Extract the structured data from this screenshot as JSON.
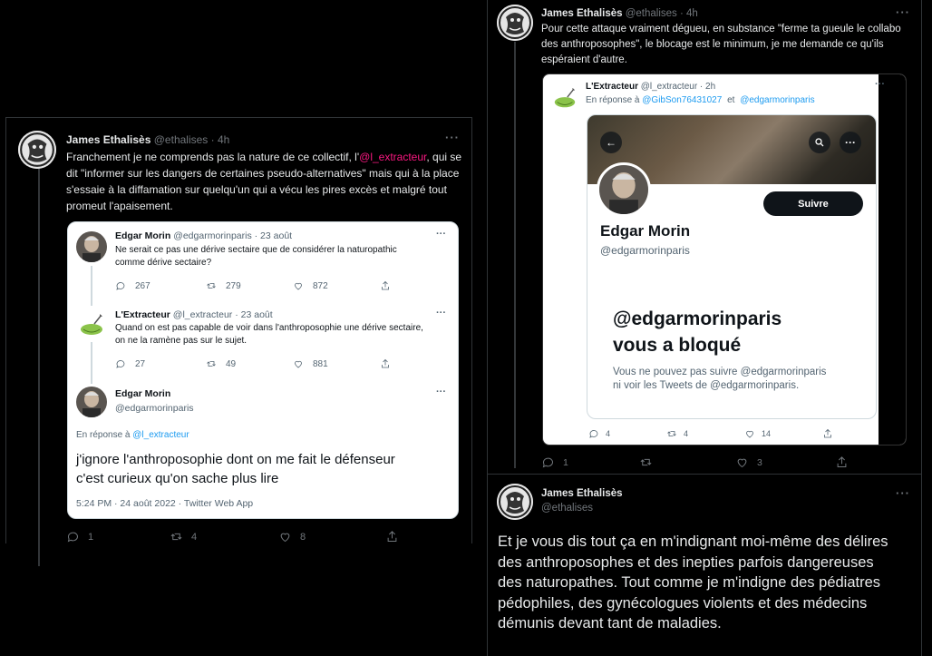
{
  "left_tweet": {
    "author": "James Ethalisès",
    "handle": "@ethalises",
    "time": "· 4h",
    "text_before": "Franchement je ne comprends pas la nature de ce collectif, l'",
    "mention": "@l_extracteur",
    "text_after": ", qui se dit \"informer sur les dangers de certaines pseudo-alternatives\" mais qui à la place s'essaie à la diffamation sur quelqu'un qui a vécu les pires excès et malgré tout promeut l'apaisement.",
    "more": "···",
    "actions": {
      "reply": "1",
      "retweet": "4",
      "like": "8"
    },
    "embedded": {
      "tweet1": {
        "author": "Edgar Morin",
        "meta": "@edgarmorinparis · 23 août",
        "text": "Ne serait ce pas une dérive sectaire que de considérer la naturopathic comme dérive sectaire?",
        "actions": {
          "reply": "267",
          "retweet": "279",
          "like": "872"
        }
      },
      "tweet2": {
        "author": "L'Extracteur",
        "meta": "@l_extracteur · 23 août",
        "text": "Quand on est pas capable de voir dans l'anthroposophie une dérive sectaire, on ne la ramène pas sur le sujet.",
        "actions": {
          "reply": "27",
          "retweet": "49",
          "like": "881"
        }
      },
      "tweet3": {
        "author": "Edgar Morin",
        "handle": "@edgarmorinparis",
        "reply_to_label": "En réponse à",
        "reply_to": "@l_extracteur",
        "text_line1": "j'ignore l'anthroposophie dont on me fait le défenseur",
        "text_line2": "c'est curieux qu'on sache plus lire",
        "footer": "5:24 PM · 24 août 2022 · Twitter Web App"
      }
    }
  },
  "right_top_tweet": {
    "author": "James Ethalisès",
    "handle": "@ethalises",
    "time": "· 4h",
    "text": "Pour cette attaque vraiment dégueu, en substance \"ferme ta gueule le collabo des anthroposophes\", le blocage est le minimum, je me demande ce qu'ils espéraient d'autre.",
    "actions": {
      "reply": "1",
      "like": "3"
    },
    "embedded": {
      "author": "L'Extracteur",
      "meta": "@l_extracteur · 2h",
      "reply_label": "En réponse à",
      "reply_user1": "@GibSon76431027",
      "reply_and": "et",
      "reply_user2": "@edgarmorinparis",
      "profile_name": "Edgar Morin",
      "profile_handle": "@edgarmorinparis",
      "follow_label": "Suivre",
      "blocked_title_line1": "@edgarmorinparis",
      "blocked_title_line2": "vous a bloqué",
      "blocked_desc_line1": "Vous ne pouvez pas suivre @edgarmorinparis",
      "blocked_desc_line2": "ni voir les Tweets de @edgarmorinparis.",
      "actions": {
        "reply": "4",
        "retweet": "4",
        "like": "14"
      }
    }
  },
  "right_bottom_tweet": {
    "author": "James Ethalisès",
    "handle": "@ethalises",
    "text": "Et je vous dis tout ça en m'indignant moi-même des délires des anthroposophes et des inepties parfois dangereuses des naturopathes. Tout comme je m'indigne des pédiatres pédophiles, des gynécologues violents et des médecins démunis devant tant de maladies."
  },
  "colors": {
    "mention": "#f91880",
    "link": "#1d9bf0",
    "background": "#000000"
  }
}
